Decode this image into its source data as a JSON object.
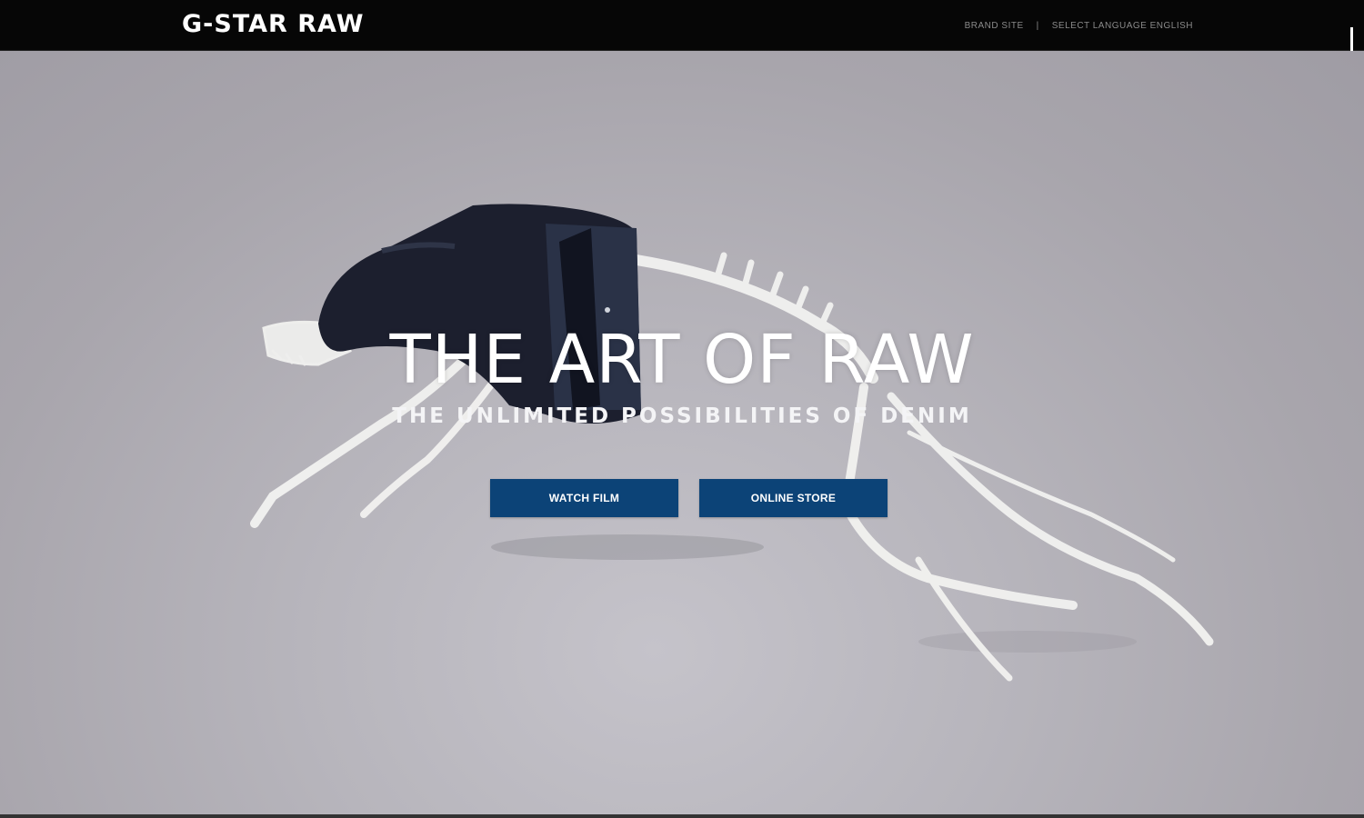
{
  "header": {
    "logo_text": "G-STAR RAW",
    "nav": {
      "brand_site": "BRAND SITE",
      "separator": "|",
      "language": "SELECT LANGUAGE ENGLISH"
    }
  },
  "hero": {
    "image_description_icon": "skeleton-dog-in-denim-jacket",
    "headline": "THE ART OF RAW",
    "subheadline": "THE UNLIMITED POSSIBILITIES OF DENIM",
    "buttons": {
      "watch_film": "WATCH FILM",
      "online_store": "ONLINE STORE"
    }
  },
  "colors": {
    "topbar": "#060606",
    "button": "#0c4377",
    "background": "#a9a6ad"
  }
}
